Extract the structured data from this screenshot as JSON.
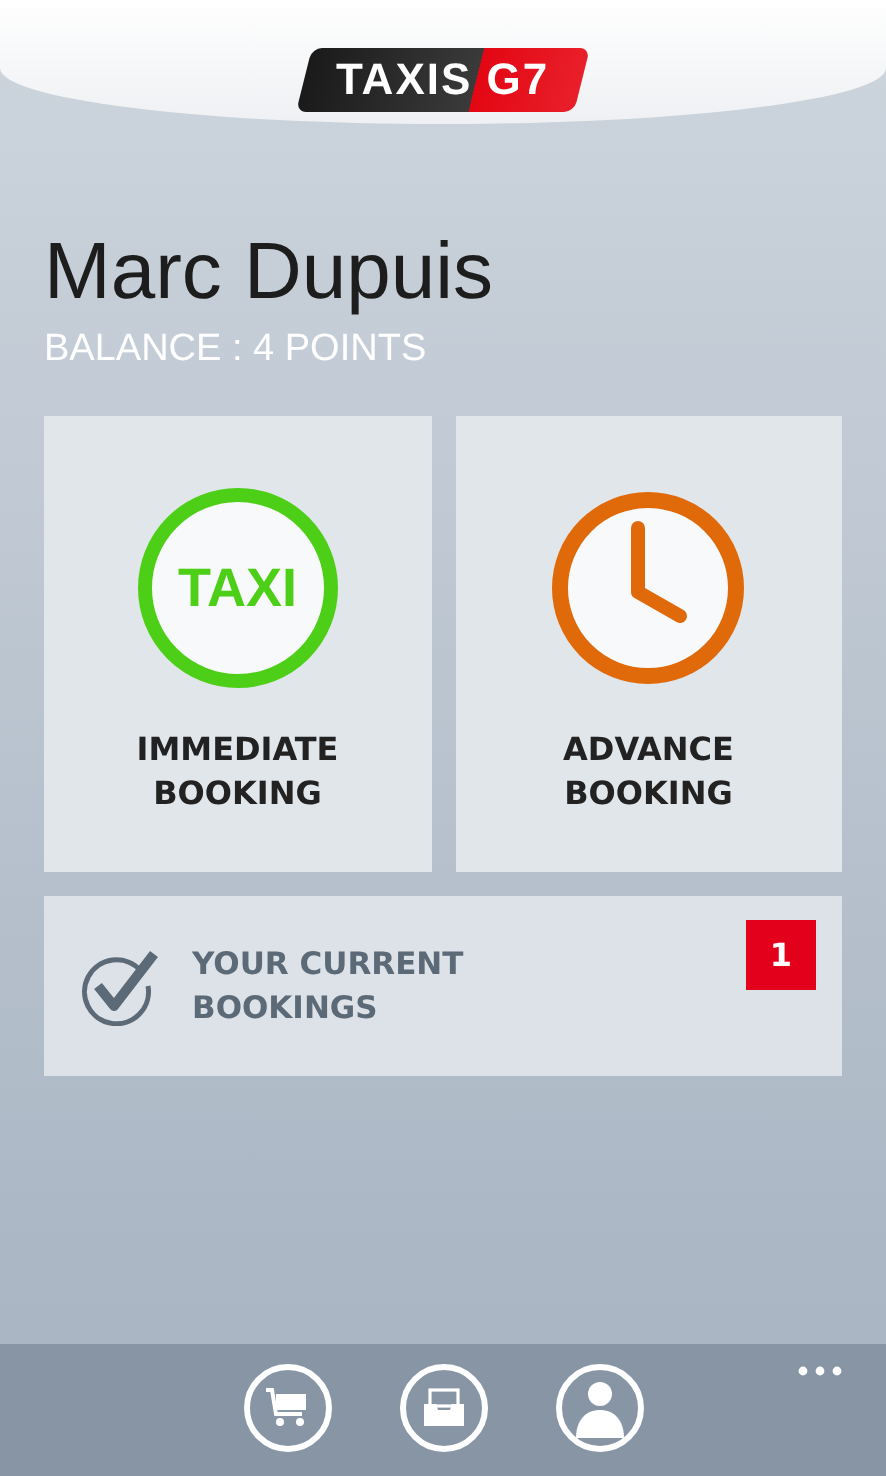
{
  "header": {
    "logo": "TAXIS G7"
  },
  "user": {
    "name": "Marc Dupuis",
    "balance": "BALANCE : 4 POINTS"
  },
  "tiles": [
    {
      "kind": "taxi",
      "icon_text": "TAXI",
      "label": [
        "IMMEDIATE",
        "BOOKING"
      ]
    },
    {
      "kind": "clock",
      "label": [
        "ADVANCE",
        "BOOKING"
      ]
    }
  ],
  "bookings": {
    "label": [
      "YOUR CURRENT",
      "BOOKINGS"
    ],
    "count": "1"
  },
  "app_bar": {
    "buttons": [
      {
        "kind": "cart"
      },
      {
        "kind": "inbox"
      },
      {
        "kind": "person"
      }
    ]
  }
}
